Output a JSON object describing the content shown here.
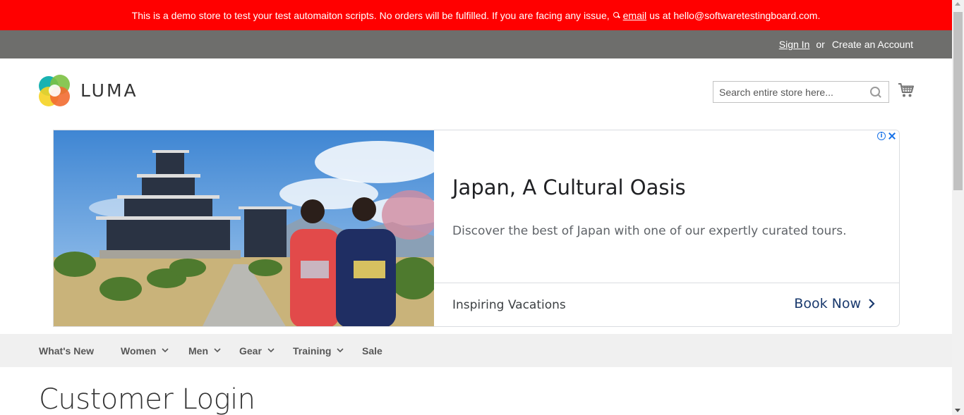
{
  "demo_banner": {
    "text_before": "This is a demo store to test your test automaiton scripts. No orders will be fulfilled. If you are facing any issue,",
    "email_label": "email",
    "text_after": "us at hello@softwaretestingboard.com."
  },
  "account": {
    "sign_in": "Sign In",
    "or": "or",
    "create_account": "Create an Account"
  },
  "header": {
    "logo_text": "LUMA",
    "search_placeholder": "Search entire store here..."
  },
  "ad": {
    "title": "Japan, A Cultural Oasis",
    "description": "Discover the best of Japan with one of our expertly curated tours.",
    "advertiser": "Inspiring Vacations",
    "cta": "Book Now"
  },
  "nav": {
    "items": [
      {
        "label": "What's New"
      },
      {
        "label": "Women"
      },
      {
        "label": "Men"
      },
      {
        "label": "Gear"
      },
      {
        "label": "Training"
      },
      {
        "label": "Sale"
      }
    ]
  },
  "page": {
    "title": "Customer Login"
  },
  "colors": {
    "banner": "#ff0000",
    "account_bar": "#6e6e6c",
    "nav_bg": "#f0f0f0"
  },
  "icons": [
    "search-icon",
    "cart-icon",
    "ad-info-icon",
    "ad-close-icon",
    "chevron-right-icon",
    "chevron-down-icon"
  ]
}
